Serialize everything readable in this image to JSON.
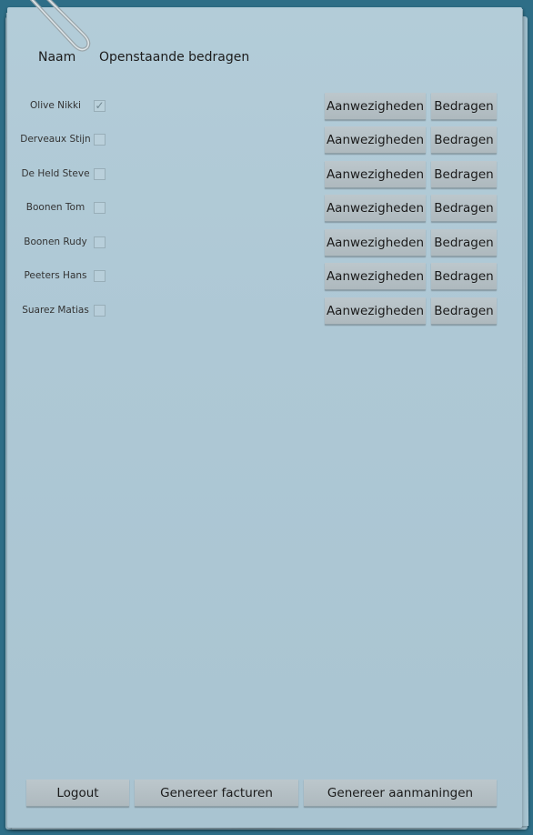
{
  "header": {
    "name_label": "Naam",
    "amounts_label": "Openstaande bedragen"
  },
  "rows": [
    {
      "name": "Olive Nikki",
      "checked": true,
      "attendance_label": "Aanwezigheden",
      "amounts_label": "Bedragen"
    },
    {
      "name": "Derveaux Stijn",
      "checked": false,
      "attendance_label": "Aanwezigheden",
      "amounts_label": "Bedragen"
    },
    {
      "name": "De Held Steve",
      "checked": false,
      "attendance_label": "Aanwezigheden",
      "amounts_label": "Bedragen"
    },
    {
      "name": "Boonen Tom",
      "checked": false,
      "attendance_label": "Aanwezigheden",
      "amounts_label": "Bedragen"
    },
    {
      "name": "Boonen Rudy",
      "checked": false,
      "attendance_label": "Aanwezigheden",
      "amounts_label": "Bedragen"
    },
    {
      "name": "Peeters Hans",
      "checked": false,
      "attendance_label": "Aanwezigheden",
      "amounts_label": "Bedragen"
    },
    {
      "name": "Suarez Matias",
      "checked": false,
      "attendance_label": "Aanwezigheden",
      "amounts_label": "Bedragen"
    }
  ],
  "footer": {
    "logout_label": "Logout",
    "generate_invoices_label": "Genereer facturen",
    "generate_reminders_label": "Genereer aanmaningen"
  },
  "colors": {
    "background": "#2e6e87",
    "paper": "#aec8d5",
    "button": "#b5c0c5"
  },
  "icons": {
    "paperclip": "paperclip-icon",
    "check": "check-icon"
  }
}
